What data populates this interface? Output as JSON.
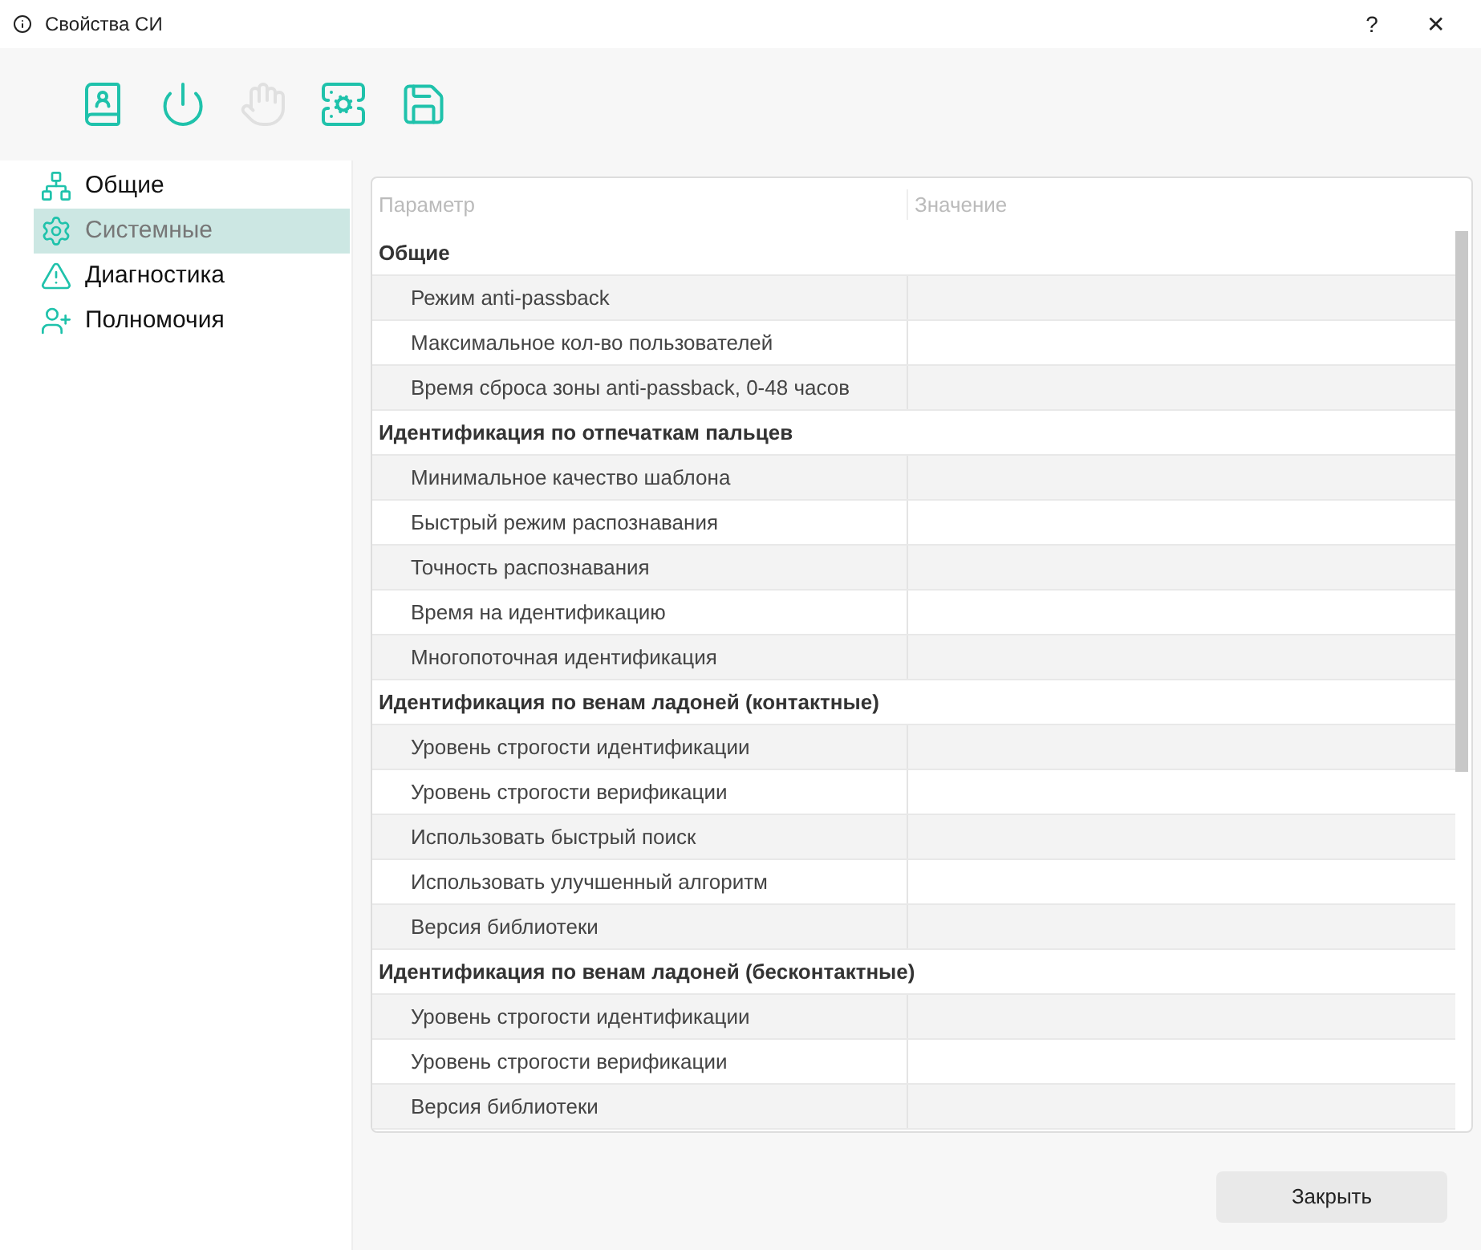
{
  "window": {
    "title": "Свойства СИ",
    "help": "?",
    "close": "✕"
  },
  "toolbar": [
    {
      "kind": "contact",
      "disabled": false
    },
    {
      "kind": "power",
      "disabled": false
    },
    {
      "kind": "hand",
      "disabled": true
    },
    {
      "kind": "server",
      "disabled": false
    },
    {
      "kind": "save",
      "disabled": false
    }
  ],
  "sidebar": {
    "items": [
      {
        "kind": "network",
        "label": "Общие",
        "selected": false
      },
      {
        "kind": "gear",
        "label": "Системные",
        "selected": true
      },
      {
        "kind": "warning",
        "label": "Диагностика",
        "selected": false
      },
      {
        "kind": "user",
        "label": "Полномочия",
        "selected": false
      }
    ]
  },
  "table": {
    "columns": [
      "Параметр",
      "Значение"
    ],
    "groups": [
      {
        "title": "Общие",
        "rows": [
          "Режим anti-passback",
          "Максимальное кол-во пользователей",
          "Время сброса зоны anti-passback, 0-48 часов"
        ]
      },
      {
        "title": "Идентификация по отпечаткам пальцев",
        "rows": [
          "Минимальное качество шаблона",
          "Быстрый режим распознавания",
          "Точность распознавания",
          "Время на идентификацию",
          "Многопоточная идентификация"
        ]
      },
      {
        "title": "Идентификация по венам ладоней (контактные)",
        "rows": [
          "Уровень строгости идентификации",
          "Уровень строгости верификации",
          "Использовать быстрый поиск",
          "Использовать улучшенный алгоритм",
          "Версия библиотеки"
        ]
      },
      {
        "title": "Идентификация по венам ладоней (бесконтактные)",
        "rows": [
          "Уровень строгости идентификации",
          "Уровень строгости верификации",
          "Версия библиотеки"
        ]
      }
    ]
  },
  "buttons": [
    "Закрыть"
  ]
}
